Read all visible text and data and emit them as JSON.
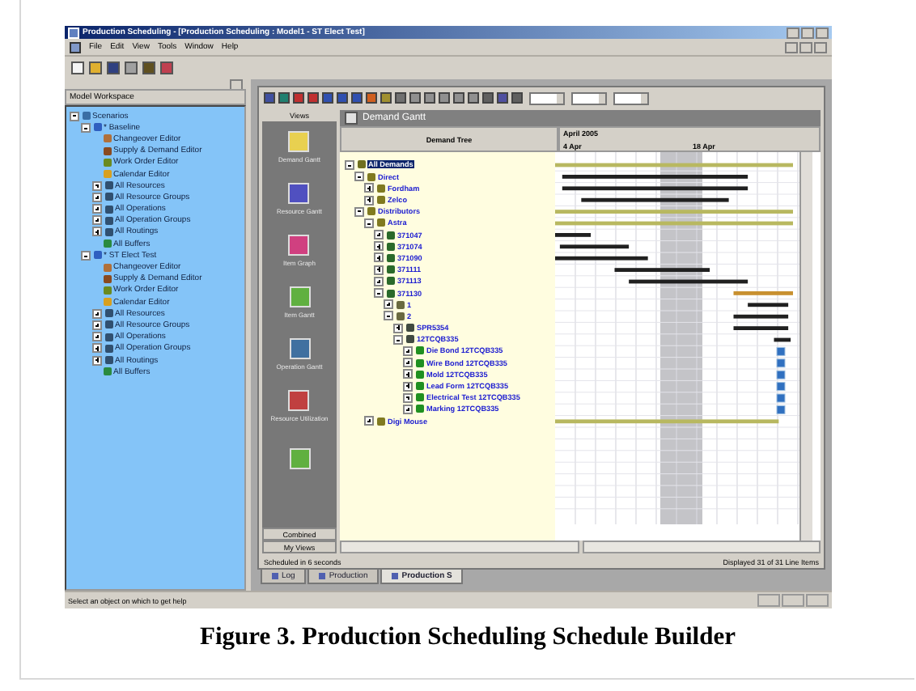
{
  "window": {
    "title": "Production Scheduling - [Production Scheduling : Model1 - ST Elect Test]"
  },
  "menu": [
    "File",
    "Edit",
    "View",
    "Tools",
    "Window",
    "Help"
  ],
  "workspace": {
    "title": "Model Workspace",
    "tree": [
      {
        "label": "Scenarios",
        "kind": "scenarios",
        "expanded": true,
        "children": [
          {
            "label": "* Baseline",
            "kind": "scenario",
            "expanded": true,
            "children": [
              {
                "label": "Changeover Editor",
                "kind": "changeover"
              },
              {
                "label": "Supply & Demand Editor",
                "kind": "supply"
              },
              {
                "label": "Work Order Editor",
                "kind": "workorder"
              },
              {
                "label": "Calendar Editor",
                "kind": "calendar"
              },
              {
                "label": "All Resources",
                "kind": "list",
                "expanded": false
              },
              {
                "label": "All Resource Groups",
                "kind": "list",
                "expanded": false
              },
              {
                "label": "All Operations",
                "kind": "list",
                "expanded": false
              },
              {
                "label": "All Operation Groups",
                "kind": "list",
                "expanded": false
              },
              {
                "label": "All Routings",
                "kind": "list",
                "expanded": false
              },
              {
                "label": "All Buffers",
                "kind": "buffer"
              }
            ]
          },
          {
            "label": "* ST Elect Test",
            "kind": "scenario",
            "expanded": true,
            "children": [
              {
                "label": "Changeover Editor",
                "kind": "changeover"
              },
              {
                "label": "Supply & Demand Editor",
                "kind": "supply"
              },
              {
                "label": "Work Order Editor",
                "kind": "workorder"
              },
              {
                "label": "Calendar Editor",
                "kind": "calendar"
              },
              {
                "label": "All Resources",
                "kind": "list",
                "expanded": false
              },
              {
                "label": "All Resource Groups",
                "kind": "list",
                "expanded": false
              },
              {
                "label": "All Operations",
                "kind": "list",
                "expanded": false
              },
              {
                "label": "All Operation Groups",
                "kind": "list",
                "expanded": false
              },
              {
                "label": "All Routings",
                "kind": "list",
                "expanded": false
              },
              {
                "label": "All Buffers",
                "kind": "buffer"
              }
            ]
          }
        ]
      }
    ]
  },
  "views": {
    "title": "Views",
    "items": [
      {
        "label": "Demand Gantt",
        "kind": "demand"
      },
      {
        "label": "Resource Gantt",
        "kind": "resource"
      },
      {
        "label": "Item Graph",
        "kind": "graph"
      },
      {
        "label": "Item Gantt",
        "kind": "item"
      },
      {
        "label": "Operation Gantt",
        "kind": "operation"
      },
      {
        "label": "Resource Utilization",
        "kind": "utilization"
      },
      {
        "kind": "item"
      }
    ],
    "buttons": [
      "Combined",
      "My Views"
    ]
  },
  "gantt": {
    "title": "Demand Gantt",
    "tree_heading": "Demand Tree",
    "month": "April 2005",
    "weeks": [
      "4 Apr",
      "18 Apr"
    ],
    "tree": [
      {
        "label": "All Demands",
        "kind": "root",
        "expanded": true,
        "selected": true,
        "children": [
          {
            "label": "Direct",
            "kind": "customer",
            "expanded": true,
            "selected": false,
            "children": [
              {
                "label": "Fordham",
                "kind": "customer",
                "expanded": false,
                "selected": false
              },
              {
                "label": "Zelco",
                "kind": "customer",
                "expanded": false,
                "selected": false
              }
            ]
          },
          {
            "label": "Distributors",
            "kind": "customer",
            "expanded": true,
            "selected": false,
            "children": [
              {
                "label": "Astra",
                "kind": "customer",
                "expanded": true,
                "selected": false,
                "children": [
                  {
                    "label": "371047",
                    "kind": "order",
                    "expanded": false,
                    "selected": false
                  },
                  {
                    "label": "371074",
                    "kind": "order",
                    "expanded": false,
                    "selected": false
                  },
                  {
                    "label": "371090",
                    "kind": "order",
                    "expanded": false,
                    "selected": false
                  },
                  {
                    "label": "371111",
                    "kind": "order",
                    "expanded": false,
                    "selected": false
                  },
                  {
                    "label": "371113",
                    "kind": "order",
                    "expanded": false,
                    "selected": false
                  },
                  {
                    "label": "371130",
                    "kind": "order",
                    "expanded": true,
                    "selected": false,
                    "children": [
                      {
                        "label": "1",
                        "kind": "line",
                        "expanded": false,
                        "selected": false
                      },
                      {
                        "label": "2",
                        "kind": "line",
                        "expanded": true,
                        "selected": false,
                        "children": [
                          {
                            "label": "SPR5354",
                            "kind": "part",
                            "expanded": false,
                            "selected": false
                          },
                          {
                            "label": "12TCQB335",
                            "kind": "part",
                            "expanded": true,
                            "selected": false,
                            "children": [
                              {
                                "label": "Die Bond 12TCQB335",
                                "kind": "operation",
                                "expanded": false,
                                "selected": false
                              },
                              {
                                "label": "Wire Bond 12TCQB335",
                                "kind": "operation",
                                "expanded": false,
                                "selected": false
                              },
                              {
                                "label": "Mold 12TCQB335",
                                "kind": "operation",
                                "expanded": false,
                                "selected": false
                              },
                              {
                                "label": "Lead Form 12TCQB335",
                                "kind": "operation",
                                "expanded": false,
                                "selected": false
                              },
                              {
                                "label": "Electrical Test 12TCQB335",
                                "kind": "operation",
                                "expanded": false,
                                "selected": false
                              },
                              {
                                "label": "Marking 12TCQB335",
                                "kind": "operation",
                                "expanded": false,
                                "selected": false
                              }
                            ]
                          }
                        ]
                      }
                    ]
                  }
                ]
              },
              {
                "label": "Digi Mouse",
                "kind": "customer",
                "expanded": false,
                "selected": false
              }
            ]
          }
        ]
      }
    ]
  },
  "status": {
    "left": "Scheduled in 6 seconds",
    "right": "Displayed 31 of 31 Line Items"
  },
  "tabs": [
    {
      "label": "Log",
      "selected": false
    },
    {
      "label": "Production",
      "selected": false
    },
    {
      "label": "Production S",
      "selected": true
    }
  ],
  "status_bar": "Select an object on which to get help",
  "caption": "Figure 3. Production Scheduling Schedule Builder"
}
